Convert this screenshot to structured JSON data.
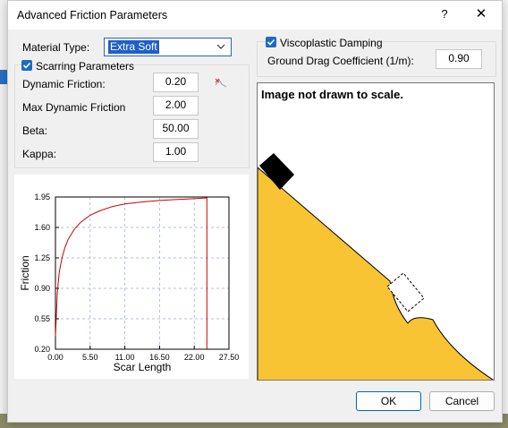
{
  "dialog": {
    "title": "Advanced Friction Parameters",
    "help_glyph": "?",
    "close_glyph": "✕"
  },
  "material": {
    "label": "Material Type:",
    "value": "Extra Soft"
  },
  "scarring": {
    "label": "Scarring Parameters",
    "checked": true,
    "dynamic_friction": {
      "label": "Dynamic Friction:",
      "value": "0.20"
    },
    "max_dynamic_friction": {
      "label": "Max Dynamic Friction",
      "value": "2.00"
    },
    "beta": {
      "label": "Beta:",
      "value": "50.00"
    },
    "kappa": {
      "label": "Kappa:",
      "value": "1.00"
    },
    "reset_icon": "reset-icon"
  },
  "viscoplastic": {
    "label": "Viscoplastic Damping",
    "checked": true,
    "ground_drag": {
      "label": "Ground Drag Coefficient (1/m):",
      "value": "0.90"
    }
  },
  "preview": {
    "note": "Image not drawn to scale."
  },
  "buttons": {
    "ok": "OK",
    "cancel": "Cancel"
  },
  "colors": {
    "accent": "#1c6bc4",
    "curve": "#cc0000",
    "slope": "#f9c433",
    "grid": "#9aa9d9"
  },
  "chart_data": {
    "type": "line",
    "title": "",
    "xlabel": "Scar Length",
    "ylabel": "Friction",
    "xlim": [
      0,
      27.5
    ],
    "ylim": [
      0.2,
      1.95
    ],
    "xticks": [
      "0.00",
      "5.50",
      "11.00",
      "16.50",
      "22.00",
      "27.50"
    ],
    "yticks": [
      "0.20",
      "0.55",
      "0.90",
      "1.25",
      "1.60",
      "1.95"
    ],
    "grid": true,
    "series": [
      {
        "x": [
          0,
          0.3,
          0.6,
          1,
          1.5,
          2,
          3,
          4,
          5.5,
          7,
          9,
          11,
          13.5,
          16.5,
          19,
          22,
          24,
          24
        ],
        "y": [
          0.35,
          0.85,
          1.08,
          1.24,
          1.37,
          1.46,
          1.58,
          1.66,
          1.74,
          1.79,
          1.84,
          1.87,
          1.89,
          1.91,
          1.92,
          1.93,
          1.94,
          0.2
        ]
      }
    ]
  }
}
